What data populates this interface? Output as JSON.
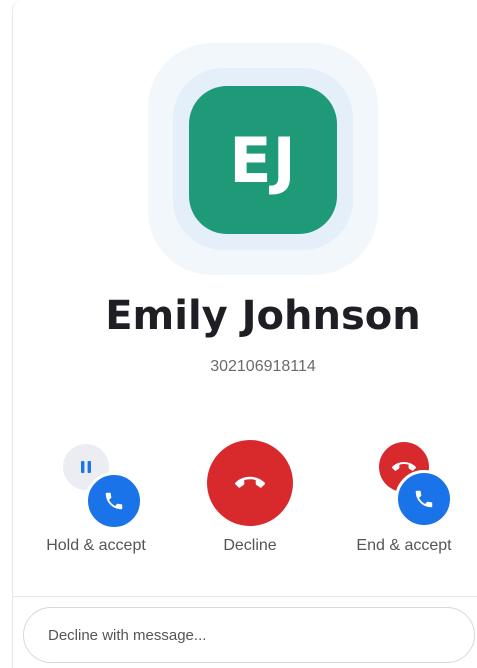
{
  "caller": {
    "initials": "EJ",
    "name": "Emily Johnson",
    "number": "302106918114",
    "avatar_color": "#1f9a78"
  },
  "actions": {
    "hold_accept": {
      "label": "Hold & accept",
      "icons": [
        "pause-icon",
        "phone-icon"
      ]
    },
    "decline": {
      "label": "Decline",
      "icon": "hang-up-icon",
      "color": "#d8292d"
    },
    "end_accept": {
      "label": "End & accept",
      "icons": [
        "hang-up-icon",
        "phone-icon"
      ]
    }
  },
  "accept_color": "#1a73e8",
  "message": {
    "placeholder": "Decline with message...",
    "value": ""
  }
}
